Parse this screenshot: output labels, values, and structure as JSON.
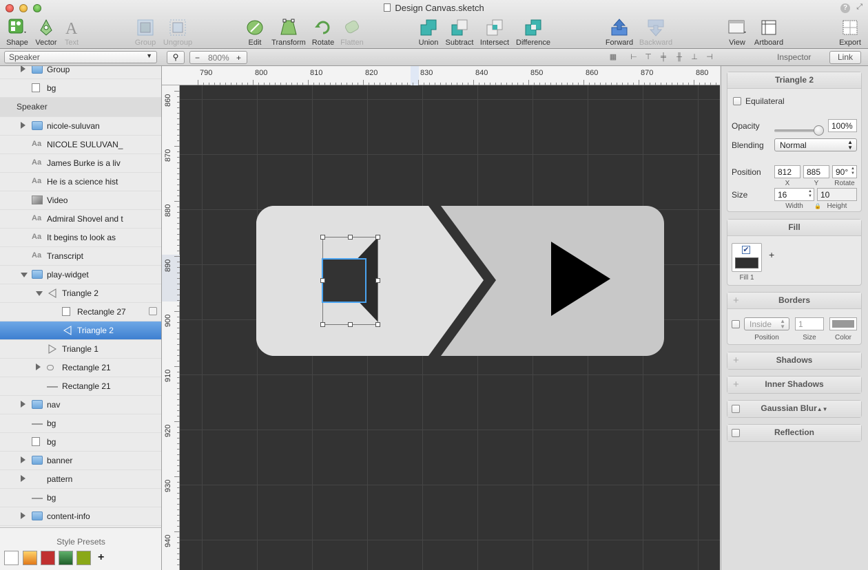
{
  "window": {
    "title": "Design Canvas.sketch"
  },
  "toolbar": {
    "shape": "Shape",
    "vector": "Vector",
    "text": "Text",
    "group": "Group",
    "ungroup": "Ungroup",
    "edit": "Edit",
    "transform": "Transform",
    "rotate": "Rotate",
    "flatten": "Flatten",
    "union": "Union",
    "subtract": "Subtract",
    "intersect": "Intersect",
    "difference": "Difference",
    "forward": "Forward",
    "backward": "Backward",
    "view": "View",
    "artboard": "Artboard",
    "export": "Export"
  },
  "subbar": {
    "page": "Speaker",
    "zoom": "800%",
    "zoom_minus": "−",
    "zoom_plus": "+",
    "inspector": "Inspector",
    "link": "Link"
  },
  "layers": [
    {
      "label": "Group",
      "icon": "folder-icon",
      "disc": "closed",
      "indent": 0
    },
    {
      "label": "bg",
      "icon": "rectangle-icon",
      "disc": "none",
      "indent": 0
    },
    {
      "label": "Speaker",
      "icon": "",
      "disc": "none",
      "indent": -1,
      "header": true
    },
    {
      "label": "nicole-suluvan",
      "icon": "folder-icon",
      "disc": "closed",
      "indent": 0
    },
    {
      "label": "NICOLE SULUVAN_",
      "icon": "text-icon",
      "disc": "none",
      "indent": 0
    },
    {
      "label": "James Burke is a liv",
      "icon": "text-icon",
      "disc": "none",
      "indent": 0
    },
    {
      "label": "He is a science hist",
      "icon": "text-icon",
      "disc": "none",
      "indent": 0
    },
    {
      "label": "Video",
      "icon": "image-icon",
      "disc": "none",
      "indent": 0
    },
    {
      "label": "Admiral Shovel and t",
      "icon": "text-icon",
      "disc": "none",
      "indent": 0
    },
    {
      "label": "It begins to look as",
      "icon": "text-icon",
      "disc": "none",
      "indent": 0
    },
    {
      "label": "Transcript",
      "icon": "text-icon",
      "disc": "none",
      "indent": 0
    },
    {
      "label": "play-widget",
      "icon": "folder-icon",
      "disc": "open",
      "indent": 0
    },
    {
      "label": "Triangle 2",
      "icon": "triangle-left-icon",
      "disc": "open",
      "indent": 1
    },
    {
      "label": "Rectangle 27",
      "icon": "rectangle-icon",
      "disc": "none",
      "indent": 2
    },
    {
      "label": "Triangle 2",
      "icon": "triangle-left-icon",
      "disc": "none",
      "indent": 2,
      "selected": true
    },
    {
      "label": "Triangle 1",
      "icon": "triangle-right-icon",
      "disc": "none",
      "indent": 1
    },
    {
      "label": "Rectangle 21",
      "icon": "rounded-rect-icon",
      "disc": "closed",
      "indent": 1
    },
    {
      "label": "Rectangle 21",
      "icon": "line-icon",
      "disc": "none",
      "indent": 1
    },
    {
      "label": "nav",
      "icon": "folder-icon",
      "disc": "closed",
      "indent": 0
    },
    {
      "label": "bg",
      "icon": "line-icon",
      "disc": "none",
      "indent": 0
    },
    {
      "label": "bg",
      "icon": "rectangle-icon",
      "disc": "none",
      "indent": 0
    },
    {
      "label": "banner",
      "icon": "folder-icon",
      "disc": "closed",
      "indent": 0
    },
    {
      "label": "pattern",
      "icon": "",
      "disc": "closed",
      "indent": 0
    },
    {
      "label": "bg",
      "icon": "line-icon",
      "disc": "none",
      "indent": 0
    },
    {
      "label": "content-info",
      "icon": "folder-icon",
      "disc": "closed",
      "indent": 0
    }
  ],
  "presets": {
    "title": "Style Presets",
    "add": "+",
    "swatches": [
      "#ffffff",
      "#f0a020",
      "#c03030",
      "#2f7f3f",
      "#8aa818"
    ]
  },
  "rulers": {
    "top": [
      "790",
      "800",
      "810",
      "820",
      "830",
      "840",
      "850",
      "860",
      "870",
      "880"
    ],
    "left": [
      "860",
      "870",
      "880",
      "890",
      "900",
      "910",
      "920",
      "930",
      "940"
    ]
  },
  "inspector": {
    "name": "Triangle 2",
    "equilateral": "Equilateral",
    "opacity_label": "Opacity",
    "opacity": "100%",
    "opacity_level": 1.0,
    "blending_label": "Blending",
    "blending": "Normal",
    "position_label": "Position",
    "x": "812",
    "y": "885",
    "rotate": "90°",
    "x_label": "X",
    "y_label": "Y",
    "rotate_label": "Rotate",
    "size_label": "Size",
    "width": "16",
    "height": "10",
    "width_label": "Width",
    "height_label": "Height",
    "fill_title": "Fill",
    "fill_item": "Fill 1",
    "fill_add": "+",
    "fill_color": "#2f2f2f",
    "borders_title": "Borders",
    "border_position": "Inside",
    "border_size": "1",
    "border_position_label": "Position",
    "border_size_label": "Size",
    "border_color_label": "Color",
    "shadows_title": "Shadows",
    "inner_shadows_title": "Inner Shadows",
    "gaussian_title": "Gaussian Blur",
    "reflection_title": "Reflection"
  },
  "colors": {
    "canvas": "#333333",
    "selection": "#4aa3f0",
    "widget_light": "#e0e0e0",
    "widget_mid": "#c8c8c8"
  }
}
